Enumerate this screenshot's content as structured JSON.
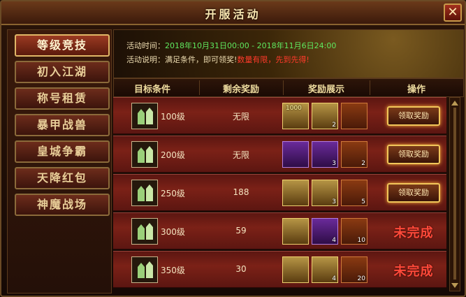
{
  "window": {
    "title": "开服活动",
    "close_label": "✕"
  },
  "sidebar": {
    "items": [
      {
        "label": "等级竞技",
        "active": true
      },
      {
        "label": "初入江湖",
        "active": false
      },
      {
        "label": "称号租赁",
        "active": false
      },
      {
        "label": "暴甲战兽",
        "active": false
      },
      {
        "label": "皇城争霸",
        "active": false
      },
      {
        "label": "天降红包",
        "active": false
      },
      {
        "label": "神魔战场",
        "active": false
      }
    ]
  },
  "banner": {
    "time_prefix": "活动时间：",
    "time_value": "2018年10月31日00:00 - 2018年11月6日24:00",
    "desc_prefix": "活动说明：满足条件，即可领奖!",
    "desc_highlight": "数量有限，先到先得!"
  },
  "table": {
    "headers": [
      "目标条件",
      "剩余奖励",
      "奖励展示",
      "操作"
    ],
    "rows": [
      {
        "level": "100级",
        "remaining": "无限",
        "rewards": [
          {
            "icon": "gold-ingot-icon",
            "count": "",
            "label": "1000"
          },
          {
            "icon": "gold-ticket-icon",
            "count": "2"
          },
          {
            "icon": "orange-gem-icon",
            "count": ""
          }
        ],
        "action": "领取奖励",
        "done": false
      },
      {
        "level": "200级",
        "remaining": "无限",
        "rewards": [
          {
            "icon": "green-armor-icon",
            "count": ""
          },
          {
            "icon": "dagger-icon",
            "count": "3"
          },
          {
            "icon": "orange-gem-icon",
            "count": "2"
          }
        ],
        "action": "领取奖励",
        "done": false
      },
      {
        "level": "250级",
        "remaining": "188",
        "rewards": [
          {
            "icon": "green-helm-icon",
            "count": ""
          },
          {
            "icon": "gold-ticket-icon",
            "count": "3"
          },
          {
            "icon": "orange-gem-icon",
            "count": "5"
          }
        ],
        "action": "领取奖励",
        "done": false
      },
      {
        "level": "300级",
        "remaining": "59",
        "rewards": [
          {
            "icon": "green-helm-icon",
            "count": ""
          },
          {
            "icon": "dagger-icon",
            "count": "4"
          },
          {
            "icon": "orange-gem-icon",
            "count": "10"
          }
        ],
        "action": "未完成",
        "done": true
      },
      {
        "level": "350级",
        "remaining": "30",
        "rewards": [
          {
            "icon": "green-ring-icon",
            "count": ""
          },
          {
            "icon": "gold-ticket-icon",
            "count": "4"
          },
          {
            "icon": "orange-gem-icon",
            "count": "20"
          }
        ],
        "action": "未完成",
        "done": true
      }
    ]
  }
}
